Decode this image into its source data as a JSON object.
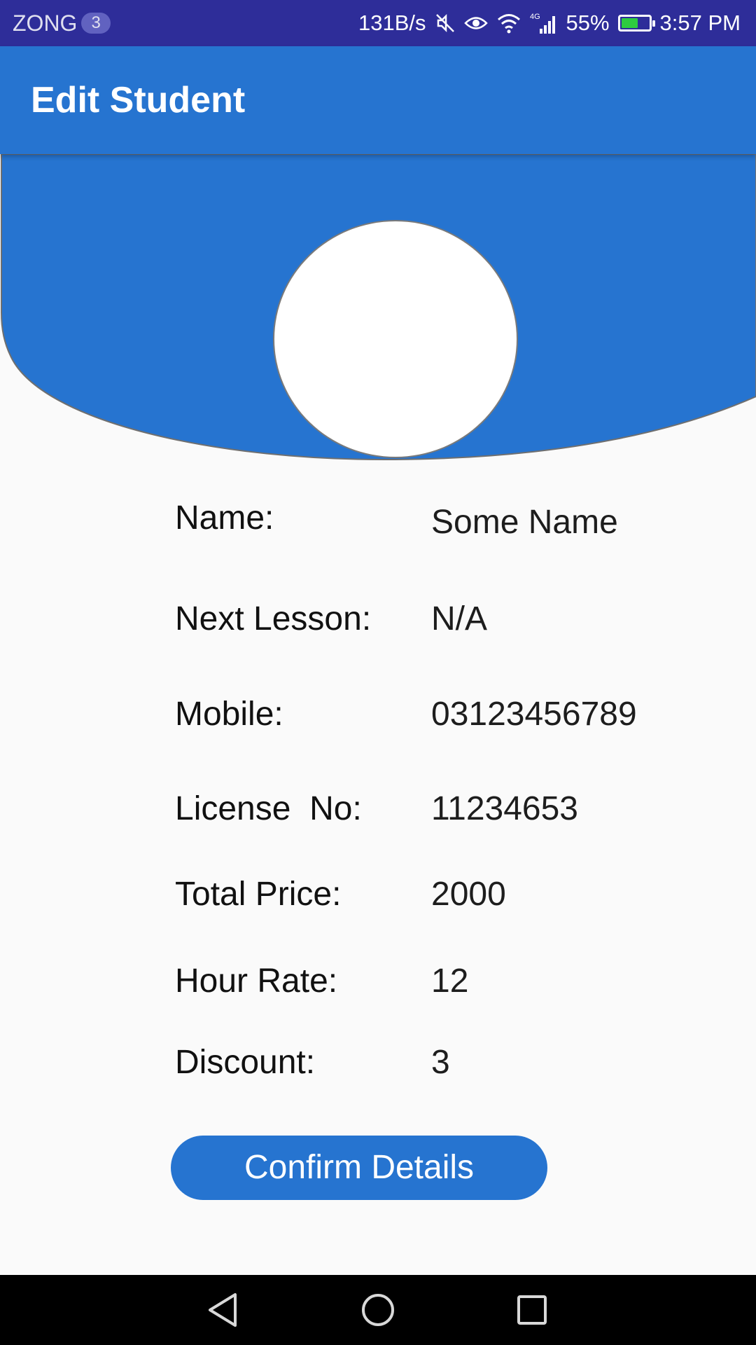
{
  "status_bar": {
    "carrier": "ZONG",
    "carrier_badge": "3",
    "network_speed": "131B/s",
    "network_type": "4G",
    "battery": "55%",
    "time": "3:57 PM",
    "icons": [
      "mute-icon",
      "eye-icon",
      "wifi-icon",
      "signal-icon",
      "battery-charging-icon"
    ]
  },
  "app_bar": {
    "title": "Edit Student"
  },
  "colors": {
    "primary": "#2674d0",
    "status_bar": "#2e2d99",
    "background": "#fafafa"
  },
  "details": {
    "name": {
      "label": "Name:",
      "value": "Some Name"
    },
    "next_lesson": {
      "label": "Next Lesson:",
      "value": "N/A"
    },
    "mobile": {
      "label": "Mobile:",
      "value": "03123456789"
    },
    "license": {
      "label": "License  No:",
      "value": "11234653"
    },
    "total_price": {
      "label": "Total Price:",
      "value": "2000"
    },
    "hour_rate": {
      "label": "Hour Rate:",
      "value": "12"
    },
    "discount": {
      "label": "Discount:",
      "value": "3"
    }
  },
  "confirm_button": {
    "label": "Confirm Details"
  },
  "nav_bar": {
    "icons": [
      "back-icon",
      "home-icon",
      "recents-icon"
    ]
  }
}
